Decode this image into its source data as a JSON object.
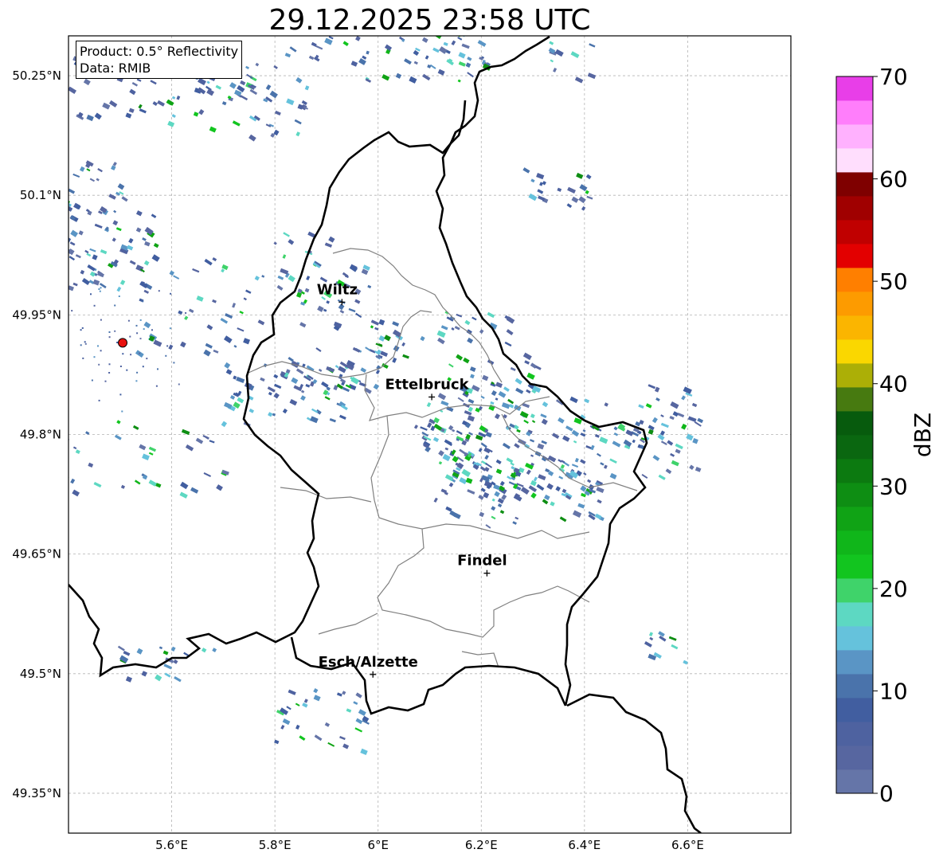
{
  "title": "29.12.2025 23:58 UTC",
  "info": {
    "product": "Product: 0.5° Reflectivity",
    "data": "Data: RMIB"
  },
  "axes": {
    "lat_ticks": [
      {
        "value": 50.25,
        "label": "50.25°N"
      },
      {
        "value": 50.1,
        "label": "50.1°N"
      },
      {
        "value": 49.95,
        "label": "49.95°N"
      },
      {
        "value": 49.8,
        "label": "49.8°N"
      },
      {
        "value": 49.65,
        "label": "49.65°N"
      },
      {
        "value": 49.5,
        "label": "49.5°N"
      },
      {
        "value": 49.35,
        "label": "49.35°N"
      }
    ],
    "lon_ticks": [
      {
        "value": 5.6,
        "label": "5.6°E"
      },
      {
        "value": 5.8,
        "label": "5.8°E"
      },
      {
        "value": 6.0,
        "label": "6°E"
      },
      {
        "value": 6.2,
        "label": "6.2°E"
      },
      {
        "value": 6.4,
        "label": "6.4°E"
      },
      {
        "value": 6.6,
        "label": "6.6°E"
      }
    ],
    "lon_range": [
      5.4,
      6.8
    ],
    "lat_range": [
      49.3,
      50.3
    ],
    "grid": true
  },
  "cities": [
    {
      "name": "Wiltz",
      "lon": 5.93,
      "lat": 49.966
    },
    {
      "name": "Ettelbruck",
      "lon": 6.104,
      "lat": 49.847
    },
    {
      "name": "Findel",
      "lon": 6.211,
      "lat": 49.626
    },
    {
      "name": "Esch/Alzette",
      "lon": 5.99,
      "lat": 49.499
    }
  ],
  "radar_site": {
    "lon": 5.505,
    "lat": 49.915,
    "color": "#e8120f"
  },
  "colorbar": {
    "label": "dBZ",
    "min": 0,
    "max": 70,
    "ticks": [
      "0",
      "10",
      "20",
      "30",
      "40",
      "50",
      "60",
      "70"
    ],
    "colors": [
      "#6575a8",
      "#5766a0",
      "#4e62a0",
      "#415ea0",
      "#4a73ab",
      "#5a95c5",
      "#65c2dc",
      "#5dd8c2",
      "#3fd36a",
      "#12c51f",
      "#10b61a",
      "#10a315",
      "#0e8e13",
      "#0c7a10",
      "#0a6710",
      "#075b0d",
      "#477a10",
      "#acaf06",
      "#fad700",
      "#fbb500",
      "#fd9b00",
      "#ff7f00",
      "#e30000",
      "#c00000",
      "#a00000",
      "#7f0000",
      "#ffdefd",
      "#ffb1fe",
      "#ff7efb",
      "#e83ee8"
    ]
  },
  "colors": {
    "border": "#000000",
    "canton": "#808080",
    "grid": "#b4b4b4"
  }
}
